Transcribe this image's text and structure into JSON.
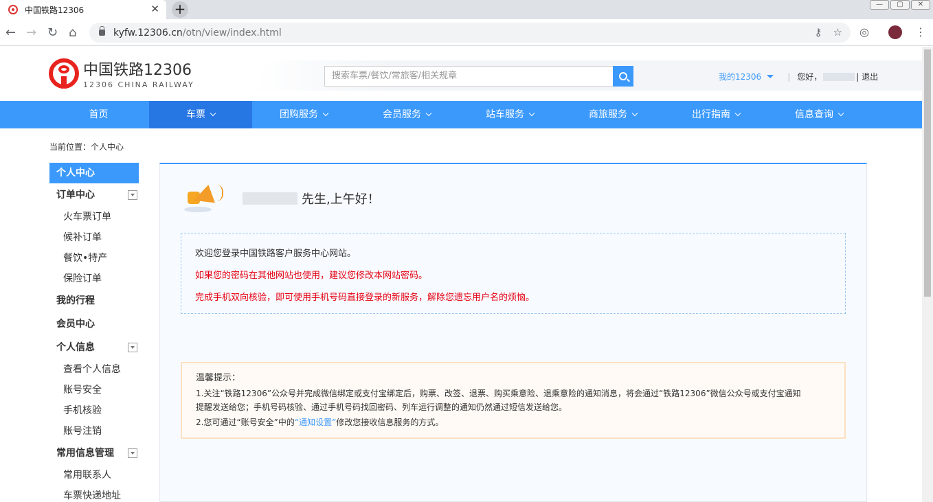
{
  "browser": {
    "tab_title": "中国铁路12306",
    "tab_close": "✕",
    "new_tab": "+",
    "window_controls": [
      "—",
      "▢",
      "✕"
    ],
    "url_domain": "kyfw.12306.cn",
    "url_path": "/otn/view/index.html",
    "nav_icons": [
      "back-icon",
      "forward-icon",
      "reload-icon",
      "home-icon"
    ],
    "omnibox_icons": [
      "key-icon",
      "star-icon"
    ],
    "extension_icons": [
      "extension-icon",
      "avatar",
      "menu-icon"
    ]
  },
  "header": {
    "logo_cn": "中国铁路12306",
    "logo_en": "12306 CHINA RAILWAY",
    "search_placeholder": "搜索车票/餐饮/常旅客/相关规章",
    "my12306": "我的12306",
    "sep": "|",
    "greeting_prefix": "您好，",
    "logout": "| 退出"
  },
  "nav": [
    {
      "label": "首页",
      "has_menu": false,
      "active": false
    },
    {
      "label": "车票",
      "has_menu": true,
      "active": true
    },
    {
      "label": "团购服务",
      "has_menu": true,
      "active": false
    },
    {
      "label": "会员服务",
      "has_menu": true,
      "active": false
    },
    {
      "label": "站车服务",
      "has_menu": true,
      "active": false
    },
    {
      "label": "商旅服务",
      "has_menu": true,
      "active": false
    },
    {
      "label": "出行指南",
      "has_menu": true,
      "active": false
    },
    {
      "label": "信息查询",
      "has_menu": true,
      "active": false
    }
  ],
  "breadcrumb": "当前位置：个人中心",
  "sidebar": {
    "active": "个人中心",
    "order_center": "订单中心",
    "order_items": [
      "火车票订单",
      "候补订单",
      "餐饮•特产",
      "保险订单"
    ],
    "my_trips": "我的行程",
    "member_center": "会员中心",
    "personal_info": "个人信息",
    "personal_items": [
      "查看个人信息",
      "账号安全",
      "手机核验",
      "账号注销"
    ],
    "common_info": "常用信息管理",
    "common_items": [
      "常用联系人",
      "车票快递地址"
    ]
  },
  "content": {
    "greeting": "先生,上午好！",
    "welcome_line": "欢迎您登录中国铁路客户服务中心网站。",
    "warn_line1": "如果您的密码在其他网站也使用，建议您修改本网站密码。",
    "warn_line2": "完成手机双向核验，即可使用手机号码直接登录的新服务，解除您遗忘用户名的烦恼。",
    "tips_title": "温馨提示：",
    "tips_line1a": "1.关注“铁路12306”公众号并完成微信绑定或支付宝绑定后，购票、改签、退票、购买乘意险、退乘意险的通知消息，将会通过“铁路12306”微信公众号或支付宝通知",
    "tips_line1b": "提醒发送给您；手机号码核验、通过手机号码找回密码、列车运行调整的通知仍然通过短信发送给您。",
    "tips_line2_pre": "2.您可通过“账号安全”中的",
    "tips_link": "“通知设置”",
    "tips_line2_post": "修改您接收信息服务的方式。"
  },
  "colors": {
    "accent": "#3b99fc",
    "nav_active": "#2676e3",
    "warning": "#e60012",
    "logo_red": "#e8231e"
  }
}
